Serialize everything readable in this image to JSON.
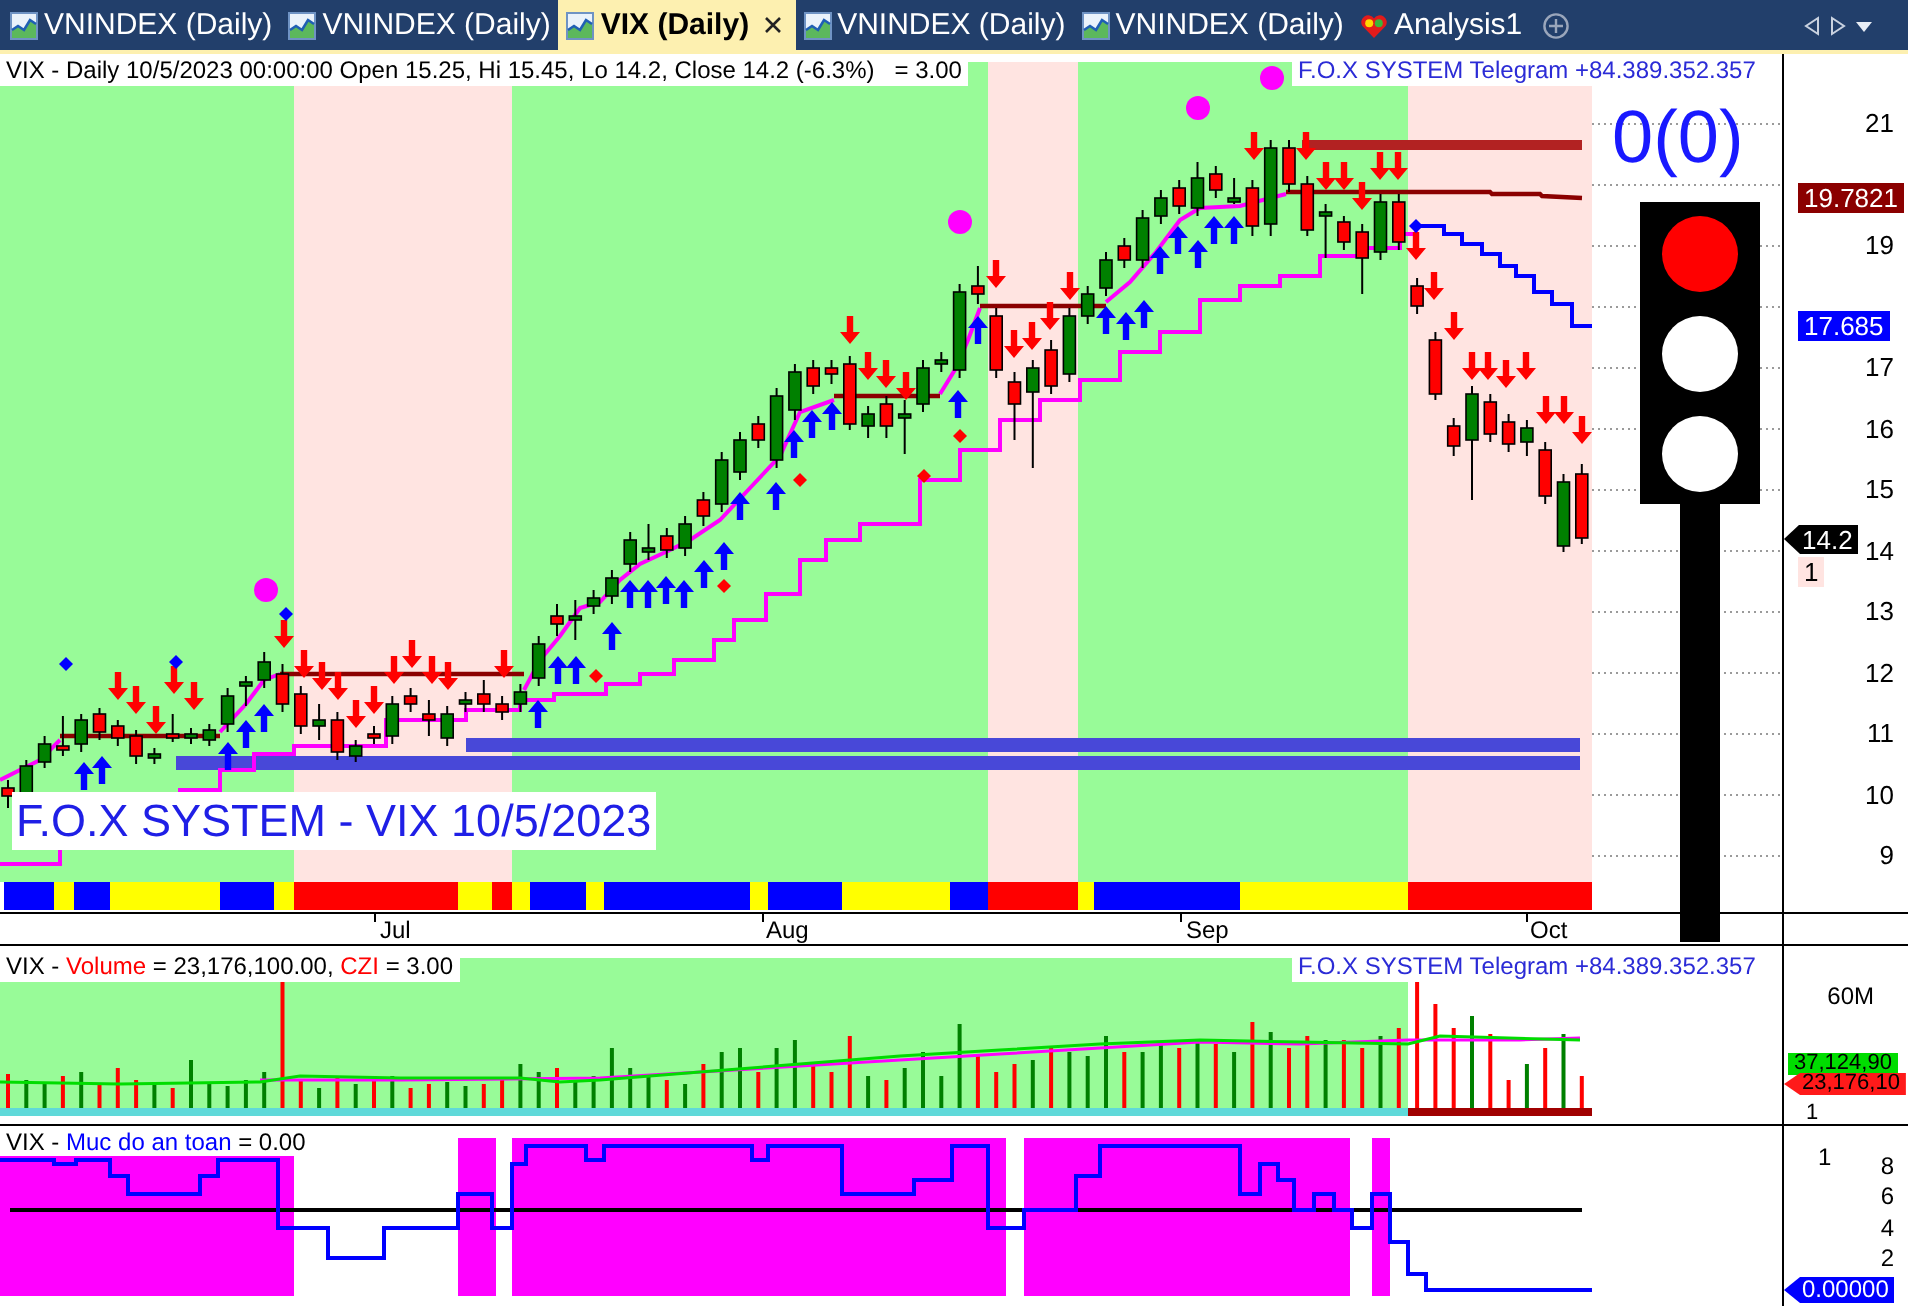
{
  "tabs": [
    {
      "label": "VNINDEX (Daily)",
      "kind": "chart",
      "selected": false
    },
    {
      "label": "VNINDEX (Daily)",
      "kind": "chart",
      "selected": false
    },
    {
      "label": "VIX (Daily)",
      "kind": "chart",
      "selected": true
    },
    {
      "label": "VNINDEX (Daily)",
      "kind": "chart",
      "selected": false
    },
    {
      "label": "VNINDEX (Daily)",
      "kind": "chart",
      "selected": false
    },
    {
      "label": "Analysis1",
      "kind": "analysis",
      "selected": false
    }
  ],
  "price_panel": {
    "header": "VIX - Daily 10/5/2023 00:00:00 Open 15.25, Hi 15.45, Lo 14.2, Close 14.2 (-6.3%)   = 3.00",
    "note": "F.O.X SYSTEM Telegram +84.389.352.357",
    "counter": "0(0)",
    "title": "F.O.X SYSTEM - VIX 10/5/2023",
    "traffic_light": [
      {
        "on": true,
        "color": "#ff0000"
      },
      {
        "on": false
      },
      {
        "on": false
      }
    ],
    "y_axis": [
      "21",
      "19",
      "17",
      "16",
      "15",
      "14",
      "13",
      "12",
      "11",
      "10",
      "9"
    ],
    "badges": [
      {
        "text": "19.7821",
        "kind": "flag",
        "color": "#8b0000"
      },
      {
        "text": "17.685",
        "kind": "flag",
        "color": "#0000ff"
      },
      {
        "text": "14.2",
        "kind": "pointer",
        "color": "#000000"
      },
      {
        "text": "1",
        "kind": "flag",
        "color": "#ffe4e1"
      }
    ]
  },
  "date_axis": [
    "Jul",
    "Aug",
    "Sep",
    "Oct"
  ],
  "volume_panel": {
    "header": [
      {
        "text": "VIX - "
      },
      {
        "text": "Volume",
        "color": "#ff0000"
      },
      {
        "text": " = 23,176,100.00, "
      },
      {
        "text": "CZI",
        "color": "#ff0000"
      },
      {
        "text": " = 3.00"
      }
    ],
    "note": "F.O.X SYSTEM Telegram +84.389.352.357",
    "y_axis": [
      "60M"
    ],
    "badges": [
      {
        "text": "37,124,90",
        "kind": "flag",
        "color": "#00dd00"
      },
      {
        "text": "23,176,10",
        "kind": "pointer",
        "color": "#ff1a1a"
      },
      {
        "text": "1",
        "kind": "plain"
      }
    ]
  },
  "safety_panel": {
    "header": [
      {
        "text": "VIX - "
      },
      {
        "text": "Muc do an toan",
        "color": "#0000ff"
      },
      {
        "text": " = 0.00"
      }
    ],
    "y_axis": [
      "8",
      "6",
      "4",
      "2"
    ],
    "badges": [
      {
        "text": "1",
        "kind": "plain"
      },
      {
        "text": "0.00000",
        "kind": "pointer",
        "color": "#0000ff"
      }
    ]
  }
}
